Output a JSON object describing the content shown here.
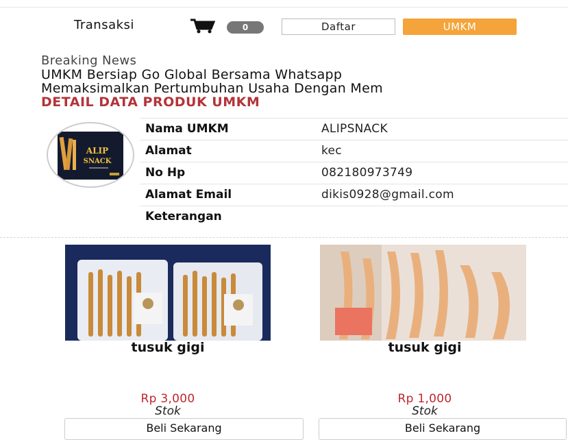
{
  "header": {
    "transaksi_label": "Transaksi",
    "cart_count": "0",
    "daftar_label": "Daftar",
    "umkm_label": "UMKM",
    "cart_icon": "shopping-cart-icon"
  },
  "news": {
    "label": "Breaking News",
    "headline_1": "UMKM Bersiap Go Global Bersama Whatsapp",
    "headline_2": "Memaksimalkan Pertumbuhan Usaha Dengan Mem"
  },
  "section_title": "DETAIL DATA PRODUK UMKM",
  "umkm": {
    "logo_text_1": "ALIP",
    "logo_text_2": "SNACK",
    "rows": [
      {
        "label": "Nama UMKM",
        "value": "ALIPSNACK"
      },
      {
        "label": "Alamat",
        "value": "kec"
      },
      {
        "label": "No Hp",
        "value": "082180973749"
      },
      {
        "label": "Alamat Email",
        "value": "dikis0928@gmail.com"
      },
      {
        "label": "Keterangan",
        "value": ""
      }
    ]
  },
  "products": [
    {
      "name": "tusuk gigi",
      "price": "Rp 3,000",
      "stock_label": "Stok",
      "button": "Beli Sekarang"
    },
    {
      "name": "tusuk gigi",
      "price": "Rp 1,000",
      "stock_label": "Stok",
      "button": "Beli Sekarang"
    }
  ],
  "colors": {
    "accent": "#f4a43a",
    "section_title": "#b3343a",
    "price": "#c0262c"
  }
}
